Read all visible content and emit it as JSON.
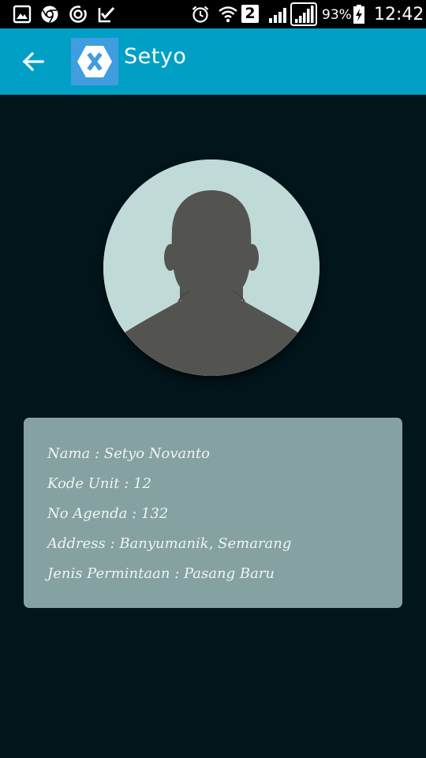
{
  "status_bar": {
    "battery_percent": "93%",
    "time": "12:42",
    "sim_slot": "2",
    "icons": [
      "image-icon",
      "chrome-icon",
      "sync-icon",
      "task-check-icon",
      "alarm-icon",
      "wifi-icon",
      "signal-icon",
      "signal-icon",
      "battery-charging-icon"
    ]
  },
  "app_bar": {
    "title": "Setyo",
    "back_icon": "arrow-left-icon",
    "logo_icon": "xamarin-logo-icon",
    "color": "#00a0c6"
  },
  "profile": {
    "avatar_icon": "user-silhouette-icon",
    "fields": [
      {
        "label": "Nama",
        "value": "Setyo Novanto"
      },
      {
        "label": "Kode Unit",
        "value": "12"
      },
      {
        "label": "No Agenda",
        "value": "132"
      },
      {
        "label": "Address",
        "value": "Banyumanik, Semarang"
      },
      {
        "label": "Jenis Permintaan",
        "value": "Pasang Baru"
      }
    ],
    "separator": ":"
  },
  "colors": {
    "background": "#02151b",
    "card": "#86a1a1",
    "avatar_bg": "#c0dad7",
    "silhouette": "#535350"
  }
}
